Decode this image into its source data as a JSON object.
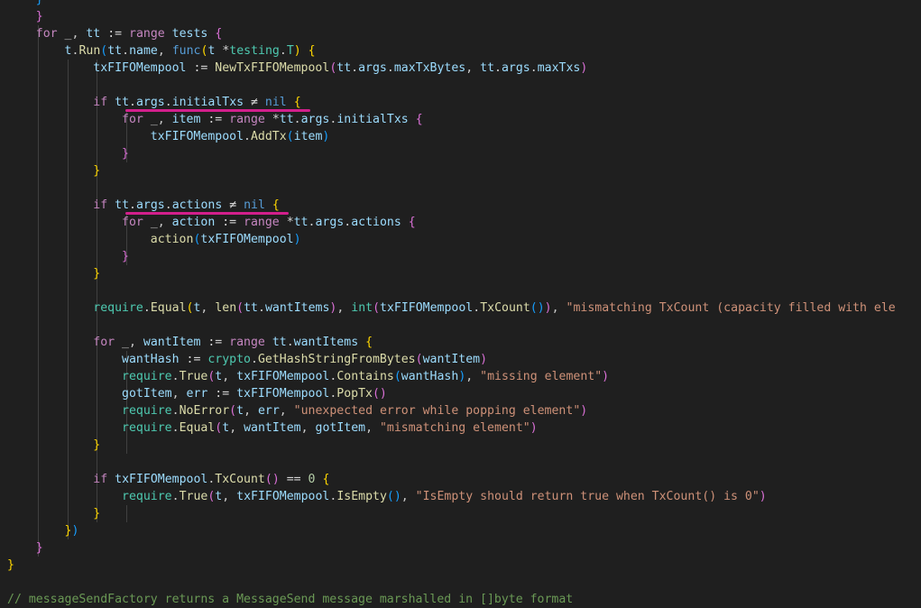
{
  "editor": {
    "lines": [
      [
        {
          "t": "    }",
          "c": "t-br3"
        }
      ],
      [
        {
          "t": "    ",
          "c": "t-pun"
        },
        {
          "t": "}",
          "c": "t-br2"
        }
      ],
      [
        {
          "t": "    ",
          "c": "t-pun"
        },
        {
          "t": "for",
          "c": "t-kw"
        },
        {
          "t": " _, ",
          "c": "t-pun"
        },
        {
          "t": "tt",
          "c": "t-var"
        },
        {
          "t": " := ",
          "c": "t-op"
        },
        {
          "t": "range",
          "c": "t-kw"
        },
        {
          "t": " ",
          "c": "t-pun"
        },
        {
          "t": "tests",
          "c": "t-var"
        },
        {
          "t": " ",
          "c": "t-pun"
        },
        {
          "t": "{",
          "c": "t-br2"
        }
      ],
      [
        {
          "t": "        ",
          "c": "t-pun"
        },
        {
          "t": "t",
          "c": "t-var"
        },
        {
          "t": ".",
          "c": "t-pun"
        },
        {
          "t": "Run",
          "c": "t-fn"
        },
        {
          "t": "(",
          "c": "t-br3"
        },
        {
          "t": "tt",
          "c": "t-var"
        },
        {
          "t": ".",
          "c": "t-pun"
        },
        {
          "t": "name",
          "c": "t-var"
        },
        {
          "t": ", ",
          "c": "t-pun"
        },
        {
          "t": "func",
          "c": "t-nil"
        },
        {
          "t": "(",
          "c": "t-br1"
        },
        {
          "t": "t",
          "c": "t-var"
        },
        {
          "t": " *",
          "c": "t-op"
        },
        {
          "t": "testing",
          "c": "t-pkg"
        },
        {
          "t": ".",
          "c": "t-pun"
        },
        {
          "t": "T",
          "c": "t-type"
        },
        {
          "t": ")",
          "c": "t-br1"
        },
        {
          "t": " ",
          "c": "t-pun"
        },
        {
          "t": "{",
          "c": "t-br1"
        }
      ],
      [
        {
          "t": "            ",
          "c": "t-pun"
        },
        {
          "t": "txFIFOMempool",
          "c": "t-var"
        },
        {
          "t": " := ",
          "c": "t-op"
        },
        {
          "t": "NewTxFIFOMempool",
          "c": "t-fn"
        },
        {
          "t": "(",
          "c": "t-br2"
        },
        {
          "t": "tt",
          "c": "t-var"
        },
        {
          "t": ".",
          "c": "t-pun"
        },
        {
          "t": "args",
          "c": "t-var"
        },
        {
          "t": ".",
          "c": "t-pun"
        },
        {
          "t": "maxTxBytes",
          "c": "t-var"
        },
        {
          "t": ", ",
          "c": "t-pun"
        },
        {
          "t": "tt",
          "c": "t-var"
        },
        {
          "t": ".",
          "c": "t-pun"
        },
        {
          "t": "args",
          "c": "t-var"
        },
        {
          "t": ".",
          "c": "t-pun"
        },
        {
          "t": "maxTxs",
          "c": "t-var"
        },
        {
          "t": ")",
          "c": "t-br2"
        }
      ],
      [],
      [
        {
          "t": "            ",
          "c": "t-pun"
        },
        {
          "t": "if",
          "c": "t-kw"
        },
        {
          "t": " ",
          "c": "t-pun"
        },
        {
          "t": "tt",
          "c": "t-var"
        },
        {
          "t": ".",
          "c": "t-pun"
        },
        {
          "t": "args",
          "c": "t-var"
        },
        {
          "t": ".",
          "c": "t-pun"
        },
        {
          "t": "initialTxs",
          "c": "t-var"
        },
        {
          "t": " ≠ ",
          "c": "t-op"
        },
        {
          "t": "nil",
          "c": "t-nil"
        },
        {
          "t": " ",
          "c": "t-pun"
        },
        {
          "t": "{",
          "c": "t-br1"
        }
      ],
      [
        {
          "t": "                ",
          "c": "t-pun"
        },
        {
          "t": "for",
          "c": "t-kw"
        },
        {
          "t": " _, ",
          "c": "t-pun"
        },
        {
          "t": "item",
          "c": "t-var"
        },
        {
          "t": " := ",
          "c": "t-op"
        },
        {
          "t": "range",
          "c": "t-kw"
        },
        {
          "t": " *",
          "c": "t-op"
        },
        {
          "t": "tt",
          "c": "t-var"
        },
        {
          "t": ".",
          "c": "t-pun"
        },
        {
          "t": "args",
          "c": "t-var"
        },
        {
          "t": ".",
          "c": "t-pun"
        },
        {
          "t": "initialTxs",
          "c": "t-var"
        },
        {
          "t": " ",
          "c": "t-pun"
        },
        {
          "t": "{",
          "c": "t-br2"
        }
      ],
      [
        {
          "t": "                    ",
          "c": "t-pun"
        },
        {
          "t": "txFIFOMempool",
          "c": "t-var"
        },
        {
          "t": ".",
          "c": "t-pun"
        },
        {
          "t": "AddTx",
          "c": "t-fn"
        },
        {
          "t": "(",
          "c": "t-br3"
        },
        {
          "t": "item",
          "c": "t-var"
        },
        {
          "t": ")",
          "c": "t-br3"
        }
      ],
      [
        {
          "t": "                ",
          "c": "t-pun"
        },
        {
          "t": "}",
          "c": "t-br2"
        }
      ],
      [
        {
          "t": "            ",
          "c": "t-pun"
        },
        {
          "t": "}",
          "c": "t-br1"
        }
      ],
      [],
      [
        {
          "t": "            ",
          "c": "t-pun"
        },
        {
          "t": "if",
          "c": "t-kw"
        },
        {
          "t": " ",
          "c": "t-pun"
        },
        {
          "t": "tt",
          "c": "t-var"
        },
        {
          "t": ".",
          "c": "t-pun"
        },
        {
          "t": "args",
          "c": "t-var"
        },
        {
          "t": ".",
          "c": "t-pun"
        },
        {
          "t": "actions",
          "c": "t-var"
        },
        {
          "t": " ≠ ",
          "c": "t-op"
        },
        {
          "t": "nil",
          "c": "t-nil"
        },
        {
          "t": " ",
          "c": "t-pun"
        },
        {
          "t": "{",
          "c": "t-br1"
        }
      ],
      [
        {
          "t": "                ",
          "c": "t-pun"
        },
        {
          "t": "for",
          "c": "t-kw"
        },
        {
          "t": " _, ",
          "c": "t-pun"
        },
        {
          "t": "action",
          "c": "t-var"
        },
        {
          "t": " := ",
          "c": "t-op"
        },
        {
          "t": "range",
          "c": "t-kw"
        },
        {
          "t": " *",
          "c": "t-op"
        },
        {
          "t": "tt",
          "c": "t-var"
        },
        {
          "t": ".",
          "c": "t-pun"
        },
        {
          "t": "args",
          "c": "t-var"
        },
        {
          "t": ".",
          "c": "t-pun"
        },
        {
          "t": "actions",
          "c": "t-var"
        },
        {
          "t": " ",
          "c": "t-pun"
        },
        {
          "t": "{",
          "c": "t-br2"
        }
      ],
      [
        {
          "t": "                    ",
          "c": "t-pun"
        },
        {
          "t": "action",
          "c": "t-fn"
        },
        {
          "t": "(",
          "c": "t-br3"
        },
        {
          "t": "txFIFOMempool",
          "c": "t-var"
        },
        {
          "t": ")",
          "c": "t-br3"
        }
      ],
      [
        {
          "t": "                ",
          "c": "t-pun"
        },
        {
          "t": "}",
          "c": "t-br2"
        }
      ],
      [
        {
          "t": "            ",
          "c": "t-pun"
        },
        {
          "t": "}",
          "c": "t-br1"
        }
      ],
      [],
      [
        {
          "t": "            ",
          "c": "t-pun"
        },
        {
          "t": "require",
          "c": "t-pkg"
        },
        {
          "t": ".",
          "c": "t-pun"
        },
        {
          "t": "Equal",
          "c": "t-fn"
        },
        {
          "t": "(",
          "c": "t-br1"
        },
        {
          "t": "t",
          "c": "t-var"
        },
        {
          "t": ", ",
          "c": "t-pun"
        },
        {
          "t": "len",
          "c": "t-fn"
        },
        {
          "t": "(",
          "c": "t-br2"
        },
        {
          "t": "tt",
          "c": "t-var"
        },
        {
          "t": ".",
          "c": "t-pun"
        },
        {
          "t": "wantItems",
          "c": "t-var"
        },
        {
          "t": ")",
          "c": "t-br2"
        },
        {
          "t": ", ",
          "c": "t-pun"
        },
        {
          "t": "int",
          "c": "t-type"
        },
        {
          "t": "(",
          "c": "t-br2"
        },
        {
          "t": "txFIFOMempool",
          "c": "t-var"
        },
        {
          "t": ".",
          "c": "t-pun"
        },
        {
          "t": "TxCount",
          "c": "t-fn"
        },
        {
          "t": "()",
          "c": "t-br3"
        },
        {
          "t": ")",
          "c": "t-br2"
        },
        {
          "t": ", ",
          "c": "t-pun"
        },
        {
          "t": "\"mismatching TxCount (capacity filled with ele",
          "c": "t-str"
        }
      ],
      [],
      [
        {
          "t": "            ",
          "c": "t-pun"
        },
        {
          "t": "for",
          "c": "t-kw"
        },
        {
          "t": " _, ",
          "c": "t-pun"
        },
        {
          "t": "wantItem",
          "c": "t-var"
        },
        {
          "t": " := ",
          "c": "t-op"
        },
        {
          "t": "range",
          "c": "t-kw"
        },
        {
          "t": " ",
          "c": "t-pun"
        },
        {
          "t": "tt",
          "c": "t-var"
        },
        {
          "t": ".",
          "c": "t-pun"
        },
        {
          "t": "wantItems",
          "c": "t-var"
        },
        {
          "t": " ",
          "c": "t-pun"
        },
        {
          "t": "{",
          "c": "t-br1"
        }
      ],
      [
        {
          "t": "                ",
          "c": "t-pun"
        },
        {
          "t": "wantHash",
          "c": "t-var"
        },
        {
          "t": " := ",
          "c": "t-op"
        },
        {
          "t": "crypto",
          "c": "t-pkg"
        },
        {
          "t": ".",
          "c": "t-pun"
        },
        {
          "t": "GetHashStringFromBytes",
          "c": "t-fn"
        },
        {
          "t": "(",
          "c": "t-br2"
        },
        {
          "t": "wantItem",
          "c": "t-var"
        },
        {
          "t": ")",
          "c": "t-br2"
        }
      ],
      [
        {
          "t": "                ",
          "c": "t-pun"
        },
        {
          "t": "require",
          "c": "t-pkg"
        },
        {
          "t": ".",
          "c": "t-pun"
        },
        {
          "t": "True",
          "c": "t-fn"
        },
        {
          "t": "(",
          "c": "t-br2"
        },
        {
          "t": "t",
          "c": "t-var"
        },
        {
          "t": ", ",
          "c": "t-pun"
        },
        {
          "t": "txFIFOMempool",
          "c": "t-var"
        },
        {
          "t": ".",
          "c": "t-pun"
        },
        {
          "t": "Contains",
          "c": "t-fn"
        },
        {
          "t": "(",
          "c": "t-br3"
        },
        {
          "t": "wantHash",
          "c": "t-var"
        },
        {
          "t": ")",
          "c": "t-br3"
        },
        {
          "t": ", ",
          "c": "t-pun"
        },
        {
          "t": "\"missing element\"",
          "c": "t-str"
        },
        {
          "t": ")",
          "c": "t-br2"
        }
      ],
      [
        {
          "t": "                ",
          "c": "t-pun"
        },
        {
          "t": "gotItem",
          "c": "t-var"
        },
        {
          "t": ", ",
          "c": "t-pun"
        },
        {
          "t": "err",
          "c": "t-var"
        },
        {
          "t": " := ",
          "c": "t-op"
        },
        {
          "t": "txFIFOMempool",
          "c": "t-var"
        },
        {
          "t": ".",
          "c": "t-pun"
        },
        {
          "t": "PopTx",
          "c": "t-fn"
        },
        {
          "t": "()",
          "c": "t-br2"
        }
      ],
      [
        {
          "t": "                ",
          "c": "t-pun"
        },
        {
          "t": "require",
          "c": "t-pkg"
        },
        {
          "t": ".",
          "c": "t-pun"
        },
        {
          "t": "NoError",
          "c": "t-fn"
        },
        {
          "t": "(",
          "c": "t-br2"
        },
        {
          "t": "t",
          "c": "t-var"
        },
        {
          "t": ", ",
          "c": "t-pun"
        },
        {
          "t": "err",
          "c": "t-var"
        },
        {
          "t": ", ",
          "c": "t-pun"
        },
        {
          "t": "\"unexpected error while popping element\"",
          "c": "t-str"
        },
        {
          "t": ")",
          "c": "t-br2"
        }
      ],
      [
        {
          "t": "                ",
          "c": "t-pun"
        },
        {
          "t": "require",
          "c": "t-pkg"
        },
        {
          "t": ".",
          "c": "t-pun"
        },
        {
          "t": "Equal",
          "c": "t-fn"
        },
        {
          "t": "(",
          "c": "t-br2"
        },
        {
          "t": "t",
          "c": "t-var"
        },
        {
          "t": ", ",
          "c": "t-pun"
        },
        {
          "t": "wantItem",
          "c": "t-var"
        },
        {
          "t": ", ",
          "c": "t-pun"
        },
        {
          "t": "gotItem",
          "c": "t-var"
        },
        {
          "t": ", ",
          "c": "t-pun"
        },
        {
          "t": "\"mismatching element\"",
          "c": "t-str"
        },
        {
          "t": ")",
          "c": "t-br2"
        }
      ],
      [
        {
          "t": "            ",
          "c": "t-pun"
        },
        {
          "t": "}",
          "c": "t-br1"
        }
      ],
      [],
      [
        {
          "t": "            ",
          "c": "t-pun"
        },
        {
          "t": "if",
          "c": "t-kw"
        },
        {
          "t": " ",
          "c": "t-pun"
        },
        {
          "t": "txFIFOMempool",
          "c": "t-var"
        },
        {
          "t": ".",
          "c": "t-pun"
        },
        {
          "t": "TxCount",
          "c": "t-fn"
        },
        {
          "t": "()",
          "c": "t-br2"
        },
        {
          "t": " == ",
          "c": "t-op"
        },
        {
          "t": "0",
          "c": "t-num"
        },
        {
          "t": " ",
          "c": "t-pun"
        },
        {
          "t": "{",
          "c": "t-br1"
        }
      ],
      [
        {
          "t": "                ",
          "c": "t-pun"
        },
        {
          "t": "require",
          "c": "t-pkg"
        },
        {
          "t": ".",
          "c": "t-pun"
        },
        {
          "t": "True",
          "c": "t-fn"
        },
        {
          "t": "(",
          "c": "t-br2"
        },
        {
          "t": "t",
          "c": "t-var"
        },
        {
          "t": ", ",
          "c": "t-pun"
        },
        {
          "t": "txFIFOMempool",
          "c": "t-var"
        },
        {
          "t": ".",
          "c": "t-pun"
        },
        {
          "t": "IsEmpty",
          "c": "t-fn"
        },
        {
          "t": "()",
          "c": "t-br3"
        },
        {
          "t": ", ",
          "c": "t-pun"
        },
        {
          "t": "\"IsEmpty should return true when TxCount() is 0\"",
          "c": "t-str"
        },
        {
          "t": ")",
          "c": "t-br2"
        }
      ],
      [
        {
          "t": "            ",
          "c": "t-pun"
        },
        {
          "t": "}",
          "c": "t-br1"
        }
      ],
      [
        {
          "t": "        ",
          "c": "t-pun"
        },
        {
          "t": "}",
          "c": "t-br1"
        },
        {
          "t": ")",
          "c": "t-br3"
        }
      ],
      [
        {
          "t": "    ",
          "c": "t-pun"
        },
        {
          "t": "}",
          "c": "t-br2"
        }
      ],
      [
        {
          "t": "}",
          "c": "t-br1"
        }
      ],
      [],
      [
        {
          "t": "// messageSendFactory returns a MessageSend message marshalled in []byte format",
          "c": "t-com"
        }
      ]
    ]
  }
}
